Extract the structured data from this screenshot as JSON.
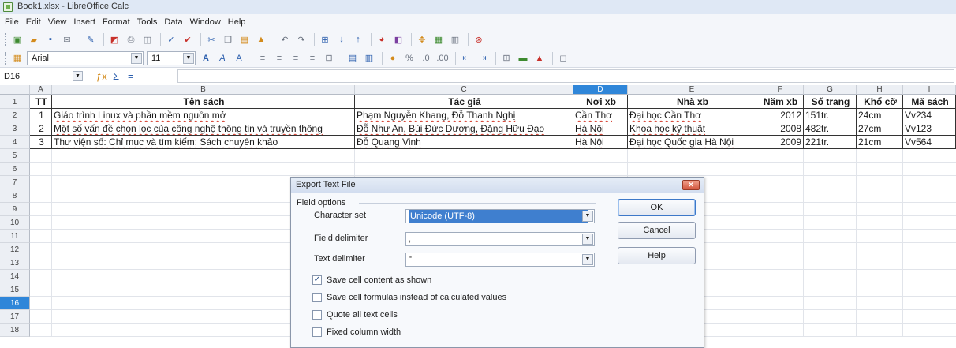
{
  "window": {
    "title": "Book1.xlsx - LibreOffice Calc"
  },
  "menu": [
    "File",
    "Edit",
    "View",
    "Insert",
    "Format",
    "Tools",
    "Data",
    "Window",
    "Help"
  ],
  "toolbar_font": {
    "name": "Arial",
    "size": "11"
  },
  "formula_bar": {
    "cell_ref": "D16",
    "content": ""
  },
  "columns": [
    "A",
    "B",
    "C",
    "D",
    "E",
    "F",
    "G",
    "H",
    "I"
  ],
  "active_column": "D",
  "rows": [
    "1",
    "2",
    "3",
    "4",
    "5",
    "6",
    "7",
    "8",
    "9",
    "10",
    "11",
    "12",
    "13",
    "14",
    "15",
    "16",
    "17",
    "18"
  ],
  "active_row": "16",
  "table": {
    "headers": [
      "TT",
      "Tên sách",
      "Tác giả",
      "Nơi xb",
      "Nhà xb",
      "Năm xb",
      "Số trang",
      "Khổ cỡ",
      "Mã sách"
    ],
    "rows": [
      [
        "1",
        "Giáo trình Linux và phần mềm nguồn mở",
        "Phạm Nguyễn Khang, Đỗ Thanh Nghị",
        "Cần Thơ",
        "Đại học Cần Thơ",
        "2012",
        "151tr.",
        "24cm",
        "Vv234"
      ],
      [
        "2",
        "Một số vấn đề chọn lọc của công nghệ thông tin và truyền thông",
        "Đỗ Như An, Bùi Đức Dương, Đặng Hữu Đạo",
        "Hà Nội",
        "Khoa học kỹ thuật",
        "2008",
        "482tr.",
        "27cm",
        "Vv123"
      ],
      [
        "3",
        "Thư viện số: Chỉ mục và tìm kiếm: Sách chuyên khảo",
        "Đỗ Quang Vinh",
        "Hà Nội",
        "Đại học Quốc gia Hà Nội",
        "2009",
        "221tr.",
        "21cm",
        "Vv564"
      ]
    ]
  },
  "dialog": {
    "title": "Export Text File",
    "section": "Field options",
    "charset_label": "Character set",
    "charset_value": "Unicode (UTF-8)",
    "field_delim_label": "Field delimiter",
    "field_delim_value": ",",
    "text_delim_label": "Text delimiter",
    "text_delim_value": "\"",
    "ok": "OK",
    "cancel": "Cancel",
    "help": "Help",
    "checkboxes": [
      {
        "label": "Save cell content as shown",
        "checked": true
      },
      {
        "label": "Save cell formulas instead of calculated values",
        "checked": false
      },
      {
        "label": "Quote all text cells",
        "checked": false
      },
      {
        "label": "Fixed column width",
        "checked": false
      }
    ]
  }
}
